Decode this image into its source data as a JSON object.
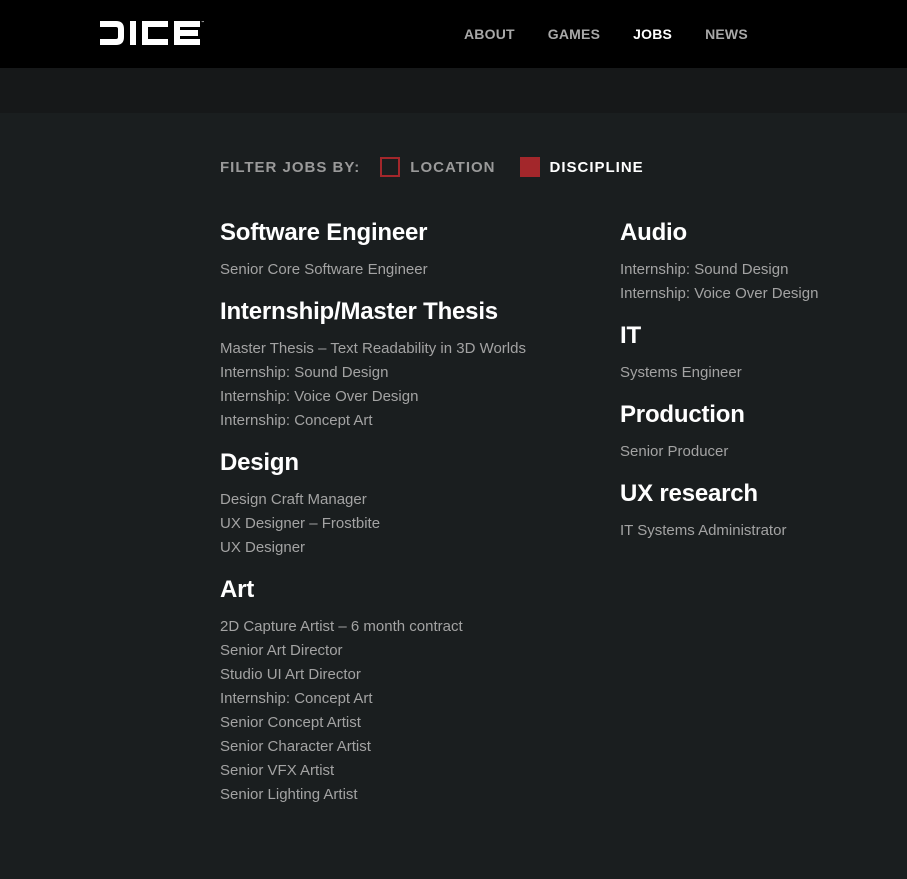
{
  "header": {
    "logo_text": "DICE",
    "nav": [
      {
        "label": "ABOUT",
        "active": false
      },
      {
        "label": "GAMES",
        "active": false
      },
      {
        "label": "JOBS",
        "active": true
      },
      {
        "label": "NEWS",
        "active": false
      }
    ]
  },
  "filter": {
    "label": "FILTER JOBS BY:",
    "options": [
      {
        "label": "LOCATION",
        "checked": false
      },
      {
        "label": "DISCIPLINE",
        "checked": true
      }
    ]
  },
  "colors": {
    "accent": "#a3272b",
    "topbar": "#000000",
    "background": "#1a1e1f"
  },
  "columns": {
    "left": [
      {
        "title": "Software Engineer",
        "jobs": [
          "Senior Core Software Engineer"
        ]
      },
      {
        "title": "Internship/Master Thesis",
        "jobs": [
          "Master Thesis – Text Readability in 3D Worlds",
          "Internship: Sound Design",
          "Internship: Voice Over Design",
          "Internship: Concept Art"
        ]
      },
      {
        "title": "Design",
        "jobs": [
          "Design Craft Manager",
          "UX Designer – Frostbite",
          "UX Designer"
        ]
      },
      {
        "title": "Art",
        "jobs": [
          "2D Capture Artist – 6 month contract",
          "Senior Art Director",
          "Studio UI Art Director",
          "Internship: Concept Art",
          "Senior Concept Artist",
          "Senior Character Artist",
          "Senior VFX Artist",
          "Senior Lighting Artist"
        ]
      }
    ],
    "right": [
      {
        "title": "Audio",
        "jobs": [
          "Internship: Sound Design",
          "Internship: Voice Over Design"
        ]
      },
      {
        "title": "IT",
        "jobs": [
          "Systems Engineer"
        ]
      },
      {
        "title": "Production",
        "jobs": [
          "Senior Producer"
        ]
      },
      {
        "title": "UX research",
        "jobs": [
          "IT Systems Administrator"
        ]
      }
    ]
  }
}
